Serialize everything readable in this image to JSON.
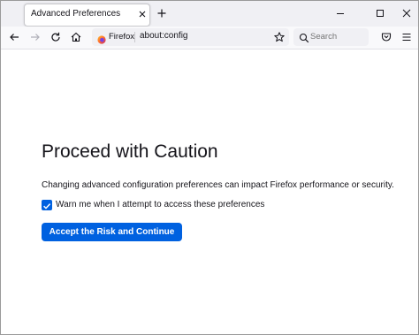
{
  "tab": {
    "title": "Advanced Preferences",
    "close_icon": "close-icon"
  },
  "toolbar": {
    "new_tab_icon": "plus-icon",
    "back_icon": "arrow-left-icon",
    "forward_icon": "arrow-right-icon",
    "reload_icon": "reload-icon",
    "home_icon": "home-icon"
  },
  "window_controls": {
    "minimize_icon": "minimize-icon",
    "maximize_icon": "maximize-icon",
    "close_icon": "close-icon"
  },
  "urlbar": {
    "identity_label": "Firefox",
    "url": "about:config",
    "bookmark_icon": "star-icon"
  },
  "searchbar": {
    "placeholder": "Search",
    "icon": "search-icon"
  },
  "pocket_icon": "pocket-icon",
  "page": {
    "heading": "Proceed with Caution",
    "description": "Changing advanced configuration preferences can impact Firefox performance or security.",
    "warn_checkbox": {
      "checked": true,
      "label": "Warn me when I attempt to access these preferences"
    },
    "accept_button": "Accept the Risk and Continue"
  },
  "colors": {
    "accent": "#0061e0",
    "tabstrip_bg": "#f0f0f4",
    "text": "#15141a"
  }
}
